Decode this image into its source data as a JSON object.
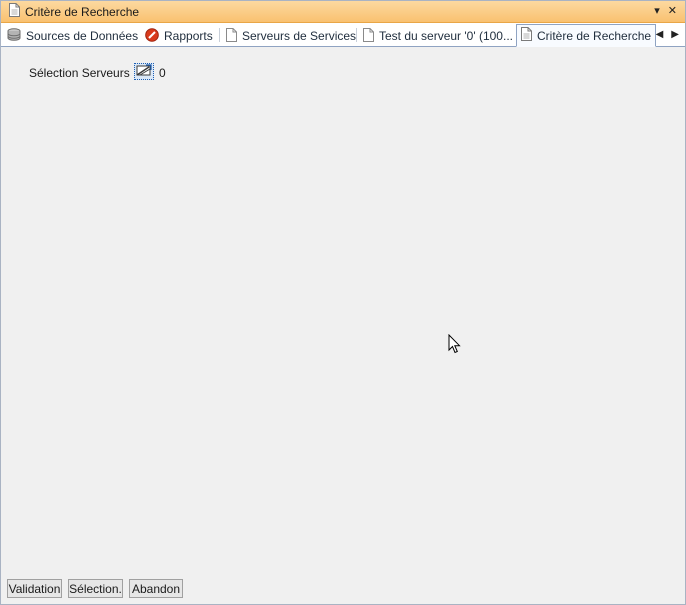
{
  "window": {
    "title": "Critère de Recherche",
    "controls": {
      "dropdown": "▾",
      "close": "✕"
    }
  },
  "tabs": [
    {
      "label": "Sources de Données",
      "icon": "database-icon",
      "active": false
    },
    {
      "label": "Rapports",
      "icon": "no-entry-icon",
      "active": false
    },
    {
      "label": "Serveurs de Services",
      "icon": "document-icon",
      "active": false
    },
    {
      "label": "Test du serveur '0' (100...",
      "icon": "document-icon",
      "active": false
    },
    {
      "label": "Critère de Recherche",
      "icon": "document-icon",
      "active": true
    }
  ],
  "tab_nav": {
    "left": "◀",
    "right": "▶"
  },
  "form": {
    "server_selection_label": "Sélection Serveurs",
    "server_selection_icon": "server-selector-icon",
    "server_count": "0"
  },
  "buttons": {
    "validation": "Validation",
    "selection": "Sélection.",
    "abandon": "Abandon"
  },
  "colors": {
    "titlebar_top": "#fcd9a0",
    "titlebar_bottom": "#f9c170",
    "no_entry_red": "#d93a1c",
    "panel_bg": "#f0f0f0"
  }
}
